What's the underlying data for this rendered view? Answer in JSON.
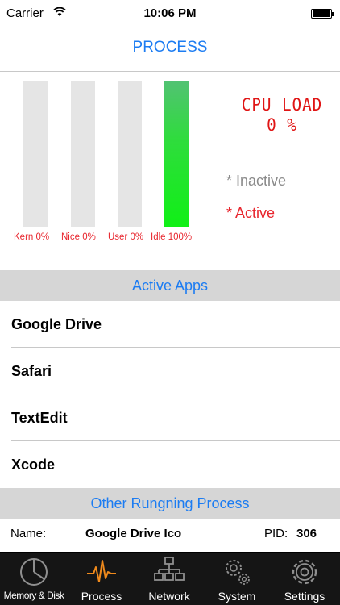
{
  "status_bar": {
    "carrier": "Carrier",
    "time": "10:06 PM"
  },
  "nav": {
    "title": "PROCESS"
  },
  "cpu": {
    "bars": [
      {
        "label": "Kern 0%",
        "value": 0
      },
      {
        "label": "Nice 0%",
        "value": 0
      },
      {
        "label": "User 0%",
        "value": 0
      },
      {
        "label": "Idle 100%",
        "value": 100
      }
    ],
    "load_title": "CPU LOAD",
    "load_value": "0 %",
    "legend_inactive": "* Inactive",
    "legend_active": "* Active",
    "active_color": "#e8262e",
    "inactive_color": "#8a8a8a"
  },
  "active_apps": {
    "header": "Active Apps",
    "items": [
      "Google Drive",
      "Safari",
      "TextEdit",
      "Xcode"
    ]
  },
  "other_process": {
    "header": "Other Rungning Process",
    "name_label": "Name:",
    "name_value": "Google Drive Ico",
    "pid_label": "PID:",
    "pid_value": "306"
  },
  "tabs": [
    {
      "label": "Memory & Disk",
      "icon": "pie-chart-icon",
      "selected": false
    },
    {
      "label": "Process",
      "icon": "pulse-icon",
      "selected": true
    },
    {
      "label": "Network",
      "icon": "network-icon",
      "selected": false
    },
    {
      "label": "System",
      "icon": "gears-icon",
      "selected": false
    },
    {
      "label": "Settings",
      "icon": "gear-icon",
      "selected": false
    }
  ],
  "colors": {
    "accent": "#1c7cf2",
    "selected_tab_icon": "#f08a1c",
    "tab_bar_bg": "#151515"
  }
}
